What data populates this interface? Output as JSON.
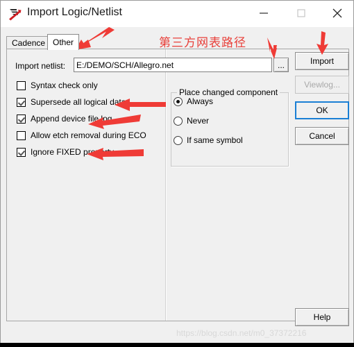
{
  "window": {
    "title": "Import Logic/Netlist",
    "icon": "allegro-app-icon",
    "controls": {
      "minimize": "minimize-icon",
      "maximize": "maximize-icon",
      "close": "close-icon"
    }
  },
  "tabs": [
    {
      "label": "Cadence",
      "selected": false
    },
    {
      "label": "Other",
      "selected": true
    }
  ],
  "form": {
    "netlist_label": "Import netlist:",
    "netlist_value": "E:/DEMO/SCH/Allegro.net",
    "netlist_placeholder": "",
    "browse_label": "..."
  },
  "checkboxes": [
    {
      "label": "Syntax check only",
      "checked": false
    },
    {
      "label": "Supersede all logical data",
      "checked": true
    },
    {
      "label": "Append device file log",
      "checked": true
    },
    {
      "label": "Allow etch removal during ECO",
      "checked": false
    },
    {
      "label": "Ignore FIXED property",
      "checked": true
    }
  ],
  "group": {
    "title": "Place changed component",
    "options": [
      {
        "label": "Always",
        "selected": true
      },
      {
        "label": "Never",
        "selected": false
      },
      {
        "label": "If same symbol",
        "selected": false
      }
    ]
  },
  "buttons": {
    "import": "Import",
    "viewlog": "Viewlog...",
    "ok": "OK",
    "cancel": "Cancel",
    "help": "Help"
  },
  "annotations": {
    "chinese_note": "第三方网表路径",
    "arrows": [
      "arrow-to-other-tab",
      "arrow-to-browse-button",
      "arrow-to-import-button",
      "arrow-to-supersede-checkbox",
      "arrow-to-append-checkbox",
      "arrow-to-ignore-fixed-checkbox"
    ]
  },
  "watermark": "https://blog.csdn.net/m0_37372216",
  "colors": {
    "annotation_red": "#e8403a",
    "focus_blue": "#1a7fd4",
    "dialog_face": "#f0f0f0",
    "titlebar": "#ffffff"
  }
}
